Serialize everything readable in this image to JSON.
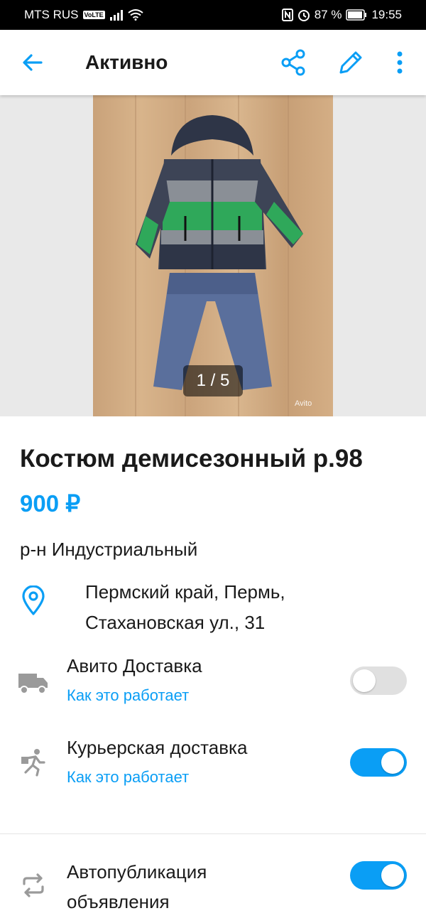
{
  "status_bar": {
    "carrier": "MTS RUS",
    "volte": "VoLTE",
    "battery": "87 %",
    "time": "19:55"
  },
  "app_bar": {
    "title": "Активно"
  },
  "gallery": {
    "counter": "1 / 5",
    "watermark": "Avito"
  },
  "listing": {
    "title": "Костюм демисезонный р.98",
    "price": "900 ₽",
    "district": "р-н Индустриальный",
    "address_line1": "Пермский край, Пермь,",
    "address_line2": "Стахановская ул., 31"
  },
  "options": [
    {
      "label": "Авито Доставка",
      "link": "Как это работает",
      "enabled": false
    },
    {
      "label": "Курьерская доставка",
      "link": "Как это работает",
      "enabled": true
    },
    {
      "label_line1": "Автопубликация",
      "label_line2": "объявления",
      "enabled": true
    }
  ],
  "colors": {
    "accent": "#0a9ef5",
    "text": "#1a1a1a"
  }
}
